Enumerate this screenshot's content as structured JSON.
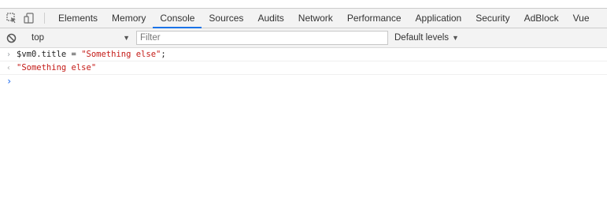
{
  "tabs": [
    "Elements",
    "Memory",
    "Console",
    "Sources",
    "Audits",
    "Network",
    "Performance",
    "Application",
    "Security",
    "AdBlock",
    "Vue"
  ],
  "active_tab": "Console",
  "toolbar": {
    "context": "top",
    "filter_placeholder": "Filter",
    "levels_label": "Default levels"
  },
  "console": {
    "input_var": "$vm0.title",
    "input_op": " = ",
    "input_string": "\"Something else\"",
    "input_end": ";",
    "result": "\"Something else\""
  },
  "icons": {
    "inspect": "inspect-element-icon",
    "device": "device-toolbar-icon",
    "clear": "clear-console-icon"
  },
  "colors": {
    "accent": "#1a73e8",
    "string": "#c41a16",
    "prompt": "#367cf1"
  }
}
